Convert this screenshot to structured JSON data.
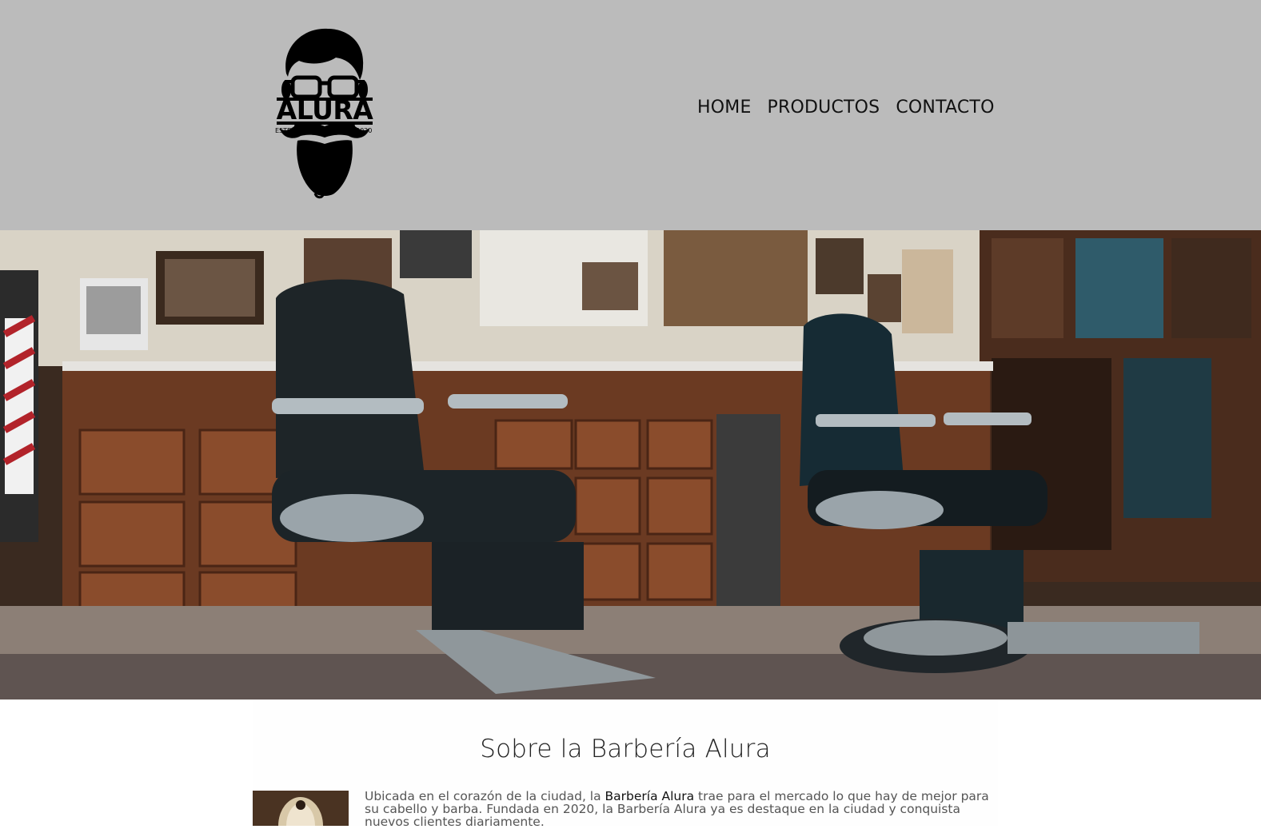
{
  "header": {
    "logo": {
      "text": "ALURA",
      "estd_label": "ESTD",
      "year_label": "2020",
      "icon": "bearded-man-logo-icon"
    },
    "nav": [
      {
        "label": "HOME"
      },
      {
        "label": "PRODUCTOS"
      },
      {
        "label": "CONTACTO"
      }
    ]
  },
  "hero": {
    "image": "barbershop-interior-photo"
  },
  "about": {
    "title": "Sobre la Barbería Alura",
    "text_before": "Ubicada en el corazón de la ciudad, la ",
    "highlight": "Barbería Alura",
    "text_after": " trae para el mercado lo que hay de mejor para su cabello y barba. Fundada en 2020, la Barbería Alura ya es destaque en la ciudad y conquista nuevos clientes diariamente.",
    "image": "shaving-brush-photo"
  },
  "colors": {
    "header_bg": "#bbbbbb",
    "nav_text": "#111111",
    "body_text": "#555555"
  }
}
